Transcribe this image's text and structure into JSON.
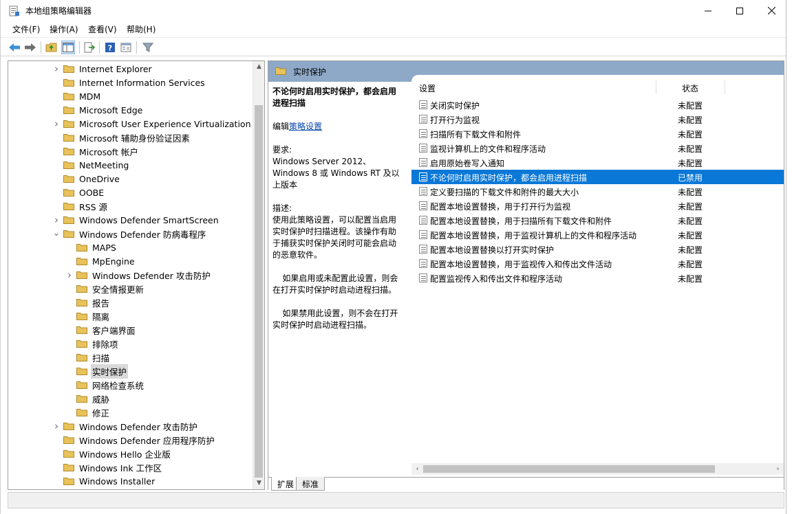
{
  "window": {
    "title": "本地组策略编辑器"
  },
  "menu": [
    "文件(F)",
    "操作(A)",
    "查看(V)",
    "帮助(H)"
  ],
  "tree": {
    "items": [
      {
        "label": "Internet Explorer",
        "expandable": true,
        "level": 0
      },
      {
        "label": "Internet Information Services",
        "expandable": false,
        "level": 0
      },
      {
        "label": "MDM",
        "expandable": false,
        "level": 0
      },
      {
        "label": "Microsoft Edge",
        "expandable": false,
        "level": 0
      },
      {
        "label": "Microsoft User Experience Virtualization",
        "expandable": true,
        "level": 0
      },
      {
        "label": "Microsoft 辅助身份验证因素",
        "expandable": false,
        "level": 0
      },
      {
        "label": "Microsoft 帐户",
        "expandable": false,
        "level": 0
      },
      {
        "label": "NetMeeting",
        "expandable": false,
        "level": 0
      },
      {
        "label": "OneDrive",
        "expandable": false,
        "level": 0
      },
      {
        "label": "OOBE",
        "expandable": false,
        "level": 0
      },
      {
        "label": "RSS 源",
        "expandable": false,
        "level": 0
      },
      {
        "label": "Windows Defender SmartScreen",
        "expandable": true,
        "level": 0
      },
      {
        "label": "Windows Defender 防病毒程序",
        "expandable": true,
        "expanded": true,
        "level": 0
      },
      {
        "label": "MAPS",
        "expandable": false,
        "level": 1
      },
      {
        "label": "MpEngine",
        "expandable": false,
        "level": 1
      },
      {
        "label": "Windows Defender 攻击防护",
        "expandable": true,
        "level": 1
      },
      {
        "label": "安全情报更新",
        "expandable": false,
        "level": 1
      },
      {
        "label": "报告",
        "expandable": false,
        "level": 1
      },
      {
        "label": "隔离",
        "expandable": false,
        "level": 1
      },
      {
        "label": "客户端界面",
        "expandable": false,
        "level": 1
      },
      {
        "label": "排除项",
        "expandable": false,
        "level": 1
      },
      {
        "label": "扫描",
        "expandable": false,
        "level": 1
      },
      {
        "label": "实时保护",
        "expandable": false,
        "level": 1,
        "selected": true
      },
      {
        "label": "网络检查系统",
        "expandable": false,
        "level": 1
      },
      {
        "label": "威胁",
        "expandable": false,
        "level": 1
      },
      {
        "label": "修正",
        "expandable": false,
        "level": 1
      },
      {
        "label": "Windows Defender 攻击防护",
        "expandable": true,
        "level": 0
      },
      {
        "label": "Windows Defender 应用程序防护",
        "expandable": false,
        "level": 0
      },
      {
        "label": "Windows Hello 企业版",
        "expandable": false,
        "level": 0
      },
      {
        "label": "Windows Ink 工作区",
        "expandable": false,
        "level": 0
      },
      {
        "label": "Windows Installer",
        "expandable": false,
        "level": 0
      }
    ]
  },
  "folder_header": "实时保护",
  "description": {
    "title": "不论何时启用实时保护，都会启用进程扫描",
    "edit_prefix": "编辑",
    "edit_link": "策略设置",
    "req_label": "要求:",
    "req_text": "Windows Server 2012、Windows 8 或 Windows RT 及以上版本",
    "desc_label": "描述:",
    "desc_text": "使用此策略设置，可以配置当启用实时保护时扫描进程。该操作有助于捕获实时保护关闭时可能会启动的恶意软件。",
    "p1": "如果启用或未配置此设置，则会在打开实时保护时启动进程扫描。",
    "p2": "如果禁用此设置，则不会在打开实时保护时启动进程扫描。"
  },
  "list": {
    "col_setting": "设置",
    "col_state": "状态",
    "rows": [
      {
        "name": "关闭实时保护",
        "state": "未配置"
      },
      {
        "name": "打开行为监视",
        "state": "未配置"
      },
      {
        "name": "扫描所有下载文件和附件",
        "state": "未配置"
      },
      {
        "name": "监视计算机上的文件和程序活动",
        "state": "未配置"
      },
      {
        "name": "启用原始卷写入通知",
        "state": "未配置"
      },
      {
        "name": "不论何时启用实时保护，都会启用进程扫描",
        "state": "已禁用",
        "selected": true
      },
      {
        "name": "定义要扫描的下载文件和附件的最大大小",
        "state": "未配置"
      },
      {
        "name": "配置本地设置替换，用于打开行为监视",
        "state": "未配置"
      },
      {
        "name": "配置本地设置替换，用于扫描所有下载文件和附件",
        "state": "未配置"
      },
      {
        "name": "配置本地设置替换，用于监视计算机上的文件和程序活动",
        "state": "未配置"
      },
      {
        "name": "配置本地设置替换以打开实时保护",
        "state": "未配置"
      },
      {
        "name": "配置本地设置替换，用于监视传入和传出文件活动",
        "state": "未配置"
      },
      {
        "name": "配置监视传入和传出文件和程序活动",
        "state": "未配置"
      }
    ]
  },
  "tabs": {
    "extended": "扩展",
    "standard": "标准"
  },
  "colors": {
    "selection": "#0a78d7",
    "header_band": "#8ea9c8",
    "folder": "#e8c25a"
  },
  "icons": [
    "back-arrow-icon",
    "forward-arrow-icon",
    "up-folder-icon",
    "show-tree-icon",
    "export-list-icon",
    "help-icon",
    "properties-icon",
    "filter-icon"
  ]
}
